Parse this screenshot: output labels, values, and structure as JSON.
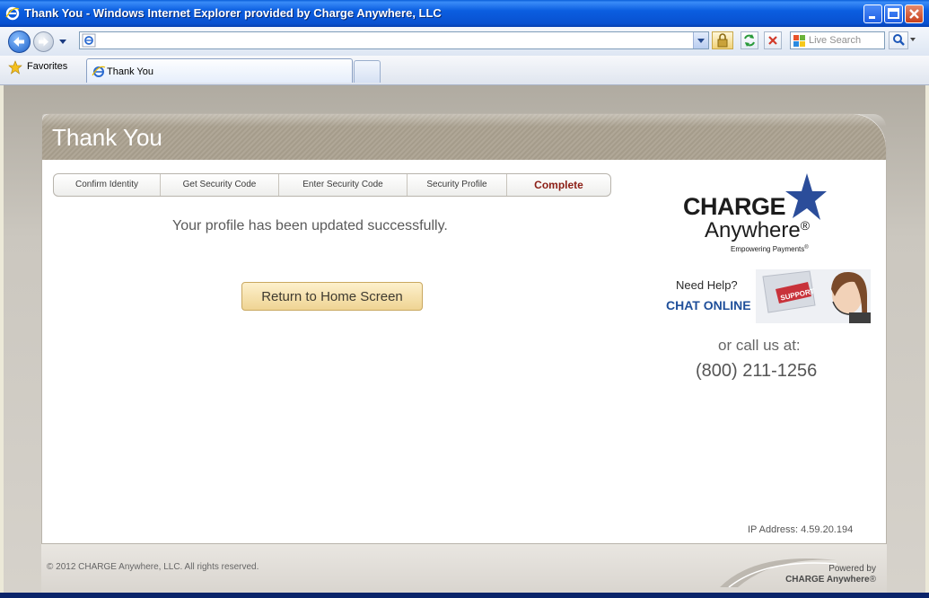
{
  "window": {
    "title": "Thank You - Windows Internet Explorer provided by Charge Anywhere, LLC"
  },
  "toolbar": {
    "address_value": "",
    "search_placeholder": "Live Search"
  },
  "favorites": {
    "label": "Favorites"
  },
  "tabs": [
    {
      "label": "Thank You"
    }
  ],
  "page": {
    "title": "Thank You",
    "steps": [
      {
        "label": "Confirm Identity",
        "active": false
      },
      {
        "label": "Get Security Code",
        "active": false
      },
      {
        "label": "Enter Security Code",
        "active": false
      },
      {
        "label": "Security Profile",
        "active": false
      },
      {
        "label": "Complete",
        "active": true
      }
    ],
    "message": "Your profile has been updated successfully.",
    "home_button": "Return to Home Screen",
    "logo": {
      "line1": "CHARGE",
      "line2": "Anywhere",
      "mark": "®",
      "tagline": "Empowering Payments",
      "tag_mark": "®"
    },
    "chat": {
      "need_help": "Need Help?",
      "chat_online": "CHAT ONLINE",
      "badge": "SUPPORT"
    },
    "call_us": "or call us at:",
    "phone": "(800) 211-1256",
    "ip": "IP Address: 4.59.20.194",
    "footer": {
      "copyright": "© 2012 CHARGE Anywhere, LLC. All rights reserved.",
      "powered_line1": "Powered by",
      "powered_line2": "CHARGE Anywhere",
      "powered_mark": "®"
    }
  },
  "colors": {
    "titlebar": "#0b5ee0",
    "step_active": "#8c1f16",
    "chat_online": "#1f4f9a",
    "home_button": "#efd493"
  }
}
